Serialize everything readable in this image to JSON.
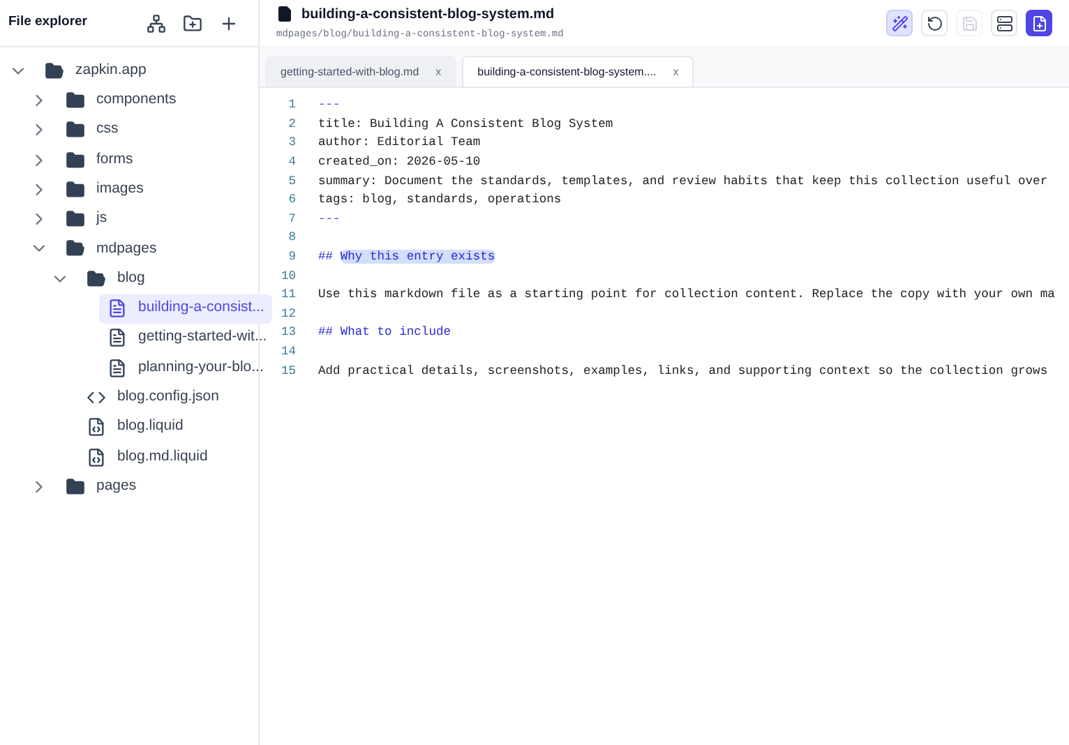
{
  "sidebar": {
    "title": "File explorer",
    "tree": [
      {
        "label": "zapkin.app",
        "kind": "folder",
        "expanded": true,
        "selected": false,
        "children": [
          {
            "label": "components",
            "kind": "folder",
            "expanded": false,
            "selected": false
          },
          {
            "label": "css",
            "kind": "folder",
            "expanded": false,
            "selected": false
          },
          {
            "label": "forms",
            "kind": "folder",
            "expanded": false,
            "selected": false
          },
          {
            "label": "images",
            "kind": "folder",
            "expanded": false,
            "selected": false
          },
          {
            "label": "js",
            "kind": "folder",
            "expanded": false,
            "selected": false
          },
          {
            "label": "mdpages",
            "kind": "folder",
            "expanded": true,
            "selected": false,
            "children": [
              {
                "label": "blog",
                "kind": "folder",
                "expanded": true,
                "selected": false,
                "children": [
                  {
                    "label": "building-a-consist...",
                    "kind": "doc",
                    "selected": true
                  },
                  {
                    "label": "getting-started-wit...",
                    "kind": "doc",
                    "selected": false
                  },
                  {
                    "label": "planning-your-blo...",
                    "kind": "doc",
                    "selected": false
                  }
                ]
              },
              {
                "label": "blog.config.json",
                "kind": "code",
                "selected": false
              },
              {
                "label": "blog.liquid",
                "kind": "liquid",
                "selected": false
              },
              {
                "label": "blog.md.liquid",
                "kind": "liquid",
                "selected": false
              }
            ]
          },
          {
            "label": "pages",
            "kind": "folder",
            "expanded": false,
            "selected": false
          }
        ]
      }
    ]
  },
  "header": {
    "filename": "building-a-consistent-blog-system.md",
    "path": "mdpages/blog/building-a-consistent-blog-system.md",
    "buttons": [
      {
        "kind": "magic",
        "active": true
      },
      {
        "kind": "undo",
        "active": false
      },
      {
        "kind": "save",
        "disabled": true
      },
      {
        "kind": "toggle",
        "active": false
      },
      {
        "kind": "new-file",
        "primary": true
      }
    ]
  },
  "tabs": [
    {
      "label": "getting-started-with-blog.md",
      "close": "x",
      "selected": false
    },
    {
      "label": "building-a-consistent-blog-system....",
      "close": "x",
      "selected": true
    }
  ],
  "editor": {
    "lines": [
      {
        "number": "1",
        "kind": "fence",
        "text": "---"
      },
      {
        "number": "2",
        "kind": "text",
        "text": "title: Building A Consistent Blog System"
      },
      {
        "number": "3",
        "kind": "text",
        "text": "author: Editorial Team"
      },
      {
        "number": "4",
        "kind": "text",
        "text": "created_on: 2026-05-10"
      },
      {
        "number": "5",
        "kind": "text",
        "text": "summary: Document the standards, templates, and review habits that keep this collection useful over"
      },
      {
        "number": "6",
        "kind": "text",
        "text": "tags: blog, standards, operations"
      },
      {
        "number": "7",
        "kind": "fence",
        "text": "---"
      },
      {
        "number": "8",
        "kind": "blank"
      },
      {
        "number": "9",
        "kind": "heading",
        "marker": "##",
        "text": "Why this entry exists",
        "highlighted": true
      },
      {
        "number": "10",
        "kind": "blank"
      },
      {
        "number": "11",
        "kind": "text",
        "text": "Use this markdown file as a starting point for collection content. Replace the copy with your own ma"
      },
      {
        "number": "12",
        "kind": "blank"
      },
      {
        "number": "13",
        "kind": "heading",
        "marker": "##",
        "text": "What to include",
        "highlighted": false
      },
      {
        "number": "14",
        "kind": "blank"
      },
      {
        "number": "15",
        "kind": "text",
        "text": "Add practical details, screenshots, examples, links, and supporting context so the collection grows"
      }
    ]
  }
}
